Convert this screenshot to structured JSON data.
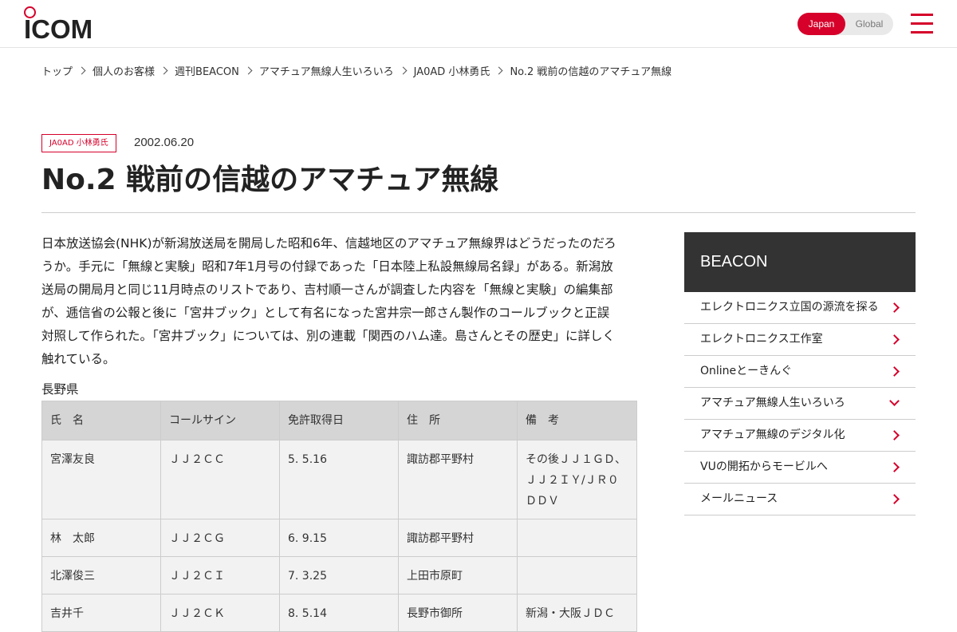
{
  "header": {
    "logo_text": "ICOM",
    "region_options": [
      "Japan",
      "Global"
    ],
    "region_selected": "Japan",
    "accent_color": "#d6002a"
  },
  "breadcrumb": [
    "トップ",
    "個人のお客様",
    "週刊BEACON",
    "アマチュア無線人生いろいろ",
    "JA0AD 小林勇氏",
    "No.2 戦前の信越のアマチュア無線"
  ],
  "article": {
    "tag": "JA0AD 小林勇氏",
    "date": "2002.06.20",
    "title": "No.2 戦前の信越のアマチュア無線",
    "body_lines": [
      "日本放送協会(NHK)が新潟放送局を開局した昭和6年、信越地区のアマチュア無線界はどうだったのだろ",
      "うか。手元に「無線と実験」昭和7年1月号の付録であった「日本陸上私設無線局名録」がある。新潟放",
      "送局の開局月と同じ11月時点のリストであり、吉村順一さんが調査した内容を「無線と実験」の編集部",
      "が、逓信省の公報と後に「宮井ブック」として有名になった宮井宗一郎さん製作のコールブックと正誤",
      "対照して作られた。「宮井ブック」については、別の連載「関西のハム達。島さんとその歴史」に詳しく",
      "触れている。"
    ],
    "prefecture": "長野県",
    "table": {
      "headers": [
        "氏　名",
        "コールサイン",
        "免許取得日",
        "住　所",
        "備　考"
      ],
      "rows": [
        [
          "宮澤友良",
          "ＪＪ２ＣＣ",
          "5. 5.16",
          "諏訪郡平野村",
          "その後ＪＪ１ＧＤ、ＪＪ２ＩＹ/ＪＲ０ＤＤＶ"
        ],
        [
          "林　太郎",
          "ＪＪ２ＣＧ",
          "6. 9.15",
          "諏訪郡平野村",
          ""
        ],
        [
          "北澤俊三",
          "ＪＪ２ＣＩ",
          "7. 3.25",
          "上田市原町",
          ""
        ],
        [
          "吉井千",
          "ＪＪ２ＣＫ",
          "8. 5.14",
          "長野市御所",
          "新潟・大阪ＪＤＣ"
        ]
      ]
    }
  },
  "sidebar": {
    "title": "BEACON",
    "items": [
      {
        "label": "エレクトロニクス立国の源流を探る",
        "icon": "chevron-right-icon"
      },
      {
        "label": "エレクトロニクス工作室",
        "icon": "chevron-right-icon"
      },
      {
        "label": "Onlineとーきんぐ",
        "icon": "chevron-right-icon"
      },
      {
        "label": "アマチュア無線人生いろいろ",
        "icon": "chevron-down-icon"
      },
      {
        "label": "アマチュア無線のデジタル化",
        "icon": "chevron-right-icon"
      },
      {
        "label": "VUの開拓からモービルへ",
        "icon": "chevron-right-icon"
      },
      {
        "label": "メールニュース",
        "icon": "chevron-right-icon"
      }
    ]
  }
}
